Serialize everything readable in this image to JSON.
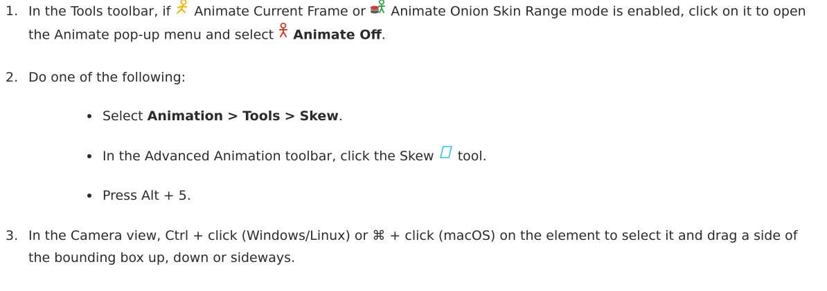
{
  "steps": [
    {
      "number": "1.",
      "part1": "In the Tools toolbar, if",
      "part2": "Animate Current Frame or",
      "part3": "Animate Onion Skin Range mode is enabled, click on it to open the Animate pop-up menu and select",
      "bold": "Animate Off",
      "end": "."
    },
    {
      "number": "2.",
      "text": "Do one of the following:"
    },
    {
      "number": "3.",
      "text": "In the Camera view, Ctrl + click (Windows/Linux) or ⌘ + click (macOS) on the element to select it and drag a side of the bounding box up, down or sideways."
    }
  ],
  "bullets": [
    {
      "pre": "Select",
      "menu1": "Animation",
      "sep1": ">",
      "menu2": "Tools",
      "sep2": ">",
      "menu3": "Skew",
      "end": "."
    },
    {
      "pre": "In the Advanced Animation toolbar, click the Skew",
      "post": "tool."
    },
    {
      "text": "Press Alt + 5."
    }
  ],
  "icons": {
    "animate_current_frame": "animate-current-frame-icon",
    "animate_onion_skin": "animate-onion-skin-icon",
    "animate_off": "animate-off-icon",
    "skew": "skew-icon"
  },
  "colors": {
    "text": "#2b2b2b",
    "animate_yellow": "#f5b400",
    "animate_red": "#d43a2a",
    "skew_blue": "#2fc3e8"
  }
}
